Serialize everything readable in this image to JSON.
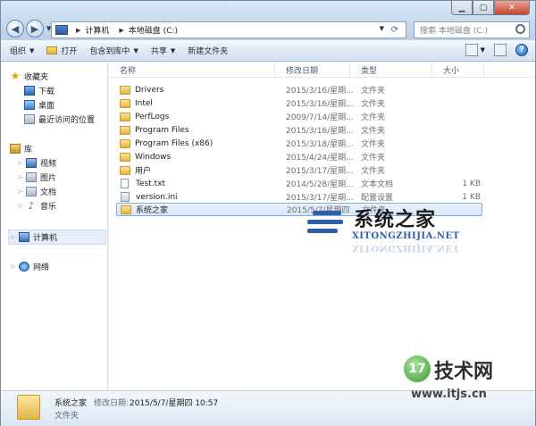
{
  "window": {
    "caption_min": "▁",
    "caption_max": "▢",
    "caption_close": "✕"
  },
  "address": {
    "crumbs": [
      "计算机",
      "本地磁盘 (C:)"
    ]
  },
  "search": {
    "placeholder": "搜索 本地磁盘 (C:)"
  },
  "toolbar": {
    "organize": "组织",
    "open": "打开",
    "include_in_library": "包含到库中",
    "share": "共享",
    "new_folder": "新建文件夹",
    "help": "?"
  },
  "nav": {
    "favorites": "收藏夹",
    "downloads": "下载",
    "desktop": "桌面",
    "recent": "最近访问的位置",
    "libraries": "库",
    "videos": "视频",
    "pictures": "图片",
    "documents": "文档",
    "music": "音乐",
    "computer": "计算机",
    "network": "网络"
  },
  "columns": {
    "name": "名称",
    "date": "修改日期",
    "type": "类型",
    "size": "大小"
  },
  "files": [
    {
      "name": "Drivers",
      "date": "2015/3/16/星期...",
      "type": "文件夹",
      "size": "",
      "kind": "folder"
    },
    {
      "name": "Intel",
      "date": "2015/3/16/星期...",
      "type": "文件夹",
      "size": "",
      "kind": "folder"
    },
    {
      "name": "PerfLogs",
      "date": "2009/7/14/星期...",
      "type": "文件夹",
      "size": "",
      "kind": "folder"
    },
    {
      "name": "Program Files",
      "date": "2015/3/16/星期...",
      "type": "文件夹",
      "size": "",
      "kind": "folder"
    },
    {
      "name": "Program Files (x86)",
      "date": "2015/3/18/星期...",
      "type": "文件夹",
      "size": "",
      "kind": "folder"
    },
    {
      "name": "Windows",
      "date": "2015/4/24/星期...",
      "type": "文件夹",
      "size": "",
      "kind": "folder"
    },
    {
      "name": "用户",
      "date": "2015/3/17/星期...",
      "type": "文件夹",
      "size": "",
      "kind": "folder"
    },
    {
      "name": "Test.txt",
      "date": "2014/5/28/星期...",
      "type": "文本文档",
      "size": "1 KB",
      "kind": "txt"
    },
    {
      "name": "version.ini",
      "date": "2015/3/17/星期...",
      "type": "配置设置",
      "size": "1 KB",
      "kind": "ini"
    },
    {
      "name": "系统之家",
      "date": "2015/5/7/星期四",
      "type": "文件夹",
      "size": "",
      "kind": "folder",
      "selected": true
    }
  ],
  "details": {
    "name": "系统之家",
    "modified_label": "修改日期:",
    "modified_value": "2015/5/7/星期四 10:57",
    "type": "文件夹"
  },
  "watermarks": {
    "site1_title": "系统之家",
    "site1_url": "XITONGZHIJIA.NET",
    "site2_badge": "17",
    "site2_title": "技术网",
    "site2_url": "www.itjs.cn"
  }
}
